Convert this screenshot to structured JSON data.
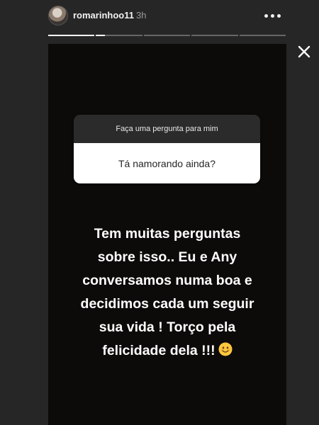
{
  "header": {
    "username": "romarinhoo11",
    "time_ago": "3h"
  },
  "progress": {
    "segment_count": 5,
    "current_segment": 1,
    "current_fraction": 0.2
  },
  "question_sticker": {
    "prompt": "Faça uma pergunta para mim",
    "question": "Tá namorando ainda?"
  },
  "caption": {
    "lines": [
      "Tem muitas perguntas",
      "sobre isso.. Eu e Any",
      "conversamos numa boa e",
      "decidimos cada um seguir",
      "sua vida ! Torço pela",
      "felicidade dela !!!"
    ],
    "emoji": "smiling-face-emoji"
  },
  "icons": {
    "more": "more-horizontal-icon",
    "close": "close-icon"
  },
  "colors": {
    "background": "#262626",
    "story_background": "#0d0b0a",
    "sticker_header": "#2b2b2b",
    "emoji_yellow": "#ffc83d"
  }
}
